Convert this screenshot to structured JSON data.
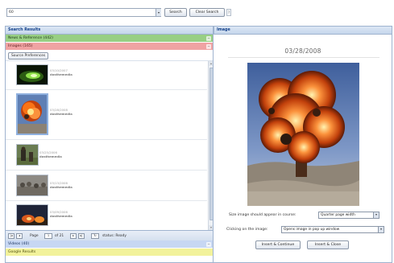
{
  "search": {
    "value": "60",
    "select_arrow": "▾",
    "search_label": "Search",
    "clear_label": "Clear Search",
    "help_glyph": "?"
  },
  "left_panel": {
    "title": "Search Results",
    "categories": {
      "news": "News & Reference (442)",
      "images": "Images (165)",
      "video": "Videos (40)",
      "google": "Google Results"
    },
    "toggle_glyph": "−",
    "source_pref_label": "Source Preferences",
    "results": [
      {
        "date": "03/10/2007",
        "source": "dosthemedia"
      },
      {
        "date": "03/28/2008",
        "source": "dosthemedia"
      },
      {
        "date": "03/25/2006",
        "source": "dosthemedia"
      },
      {
        "date": "03/13/2006",
        "source": "dosthemedia"
      },
      {
        "date": "03/09/2006",
        "source": "dosthemedia"
      }
    ],
    "pager": {
      "first": "|◂",
      "prev": "◂",
      "page_label": "Page",
      "page_value": "1",
      "of_label": "of 21",
      "next": "▸",
      "last": "▸|",
      "refresh": "↻",
      "status": "status: Ready"
    }
  },
  "right_panel": {
    "title": "Image",
    "date": "03/28/2008",
    "size_label": "Size image should appear in course:",
    "size_value": "Quarter page width",
    "click_label": "Clicking on the image:",
    "click_value": "Opens image in pop up window",
    "arrow": "▾",
    "insert_continue": "Insert & Continue",
    "insert_close": "Insert & Close"
  },
  "colors": {
    "accent": "#15428b",
    "news": "#98cf84",
    "images": "#f0a3a3",
    "video": "#c7d7f3",
    "google": "#f2f29b"
  }
}
